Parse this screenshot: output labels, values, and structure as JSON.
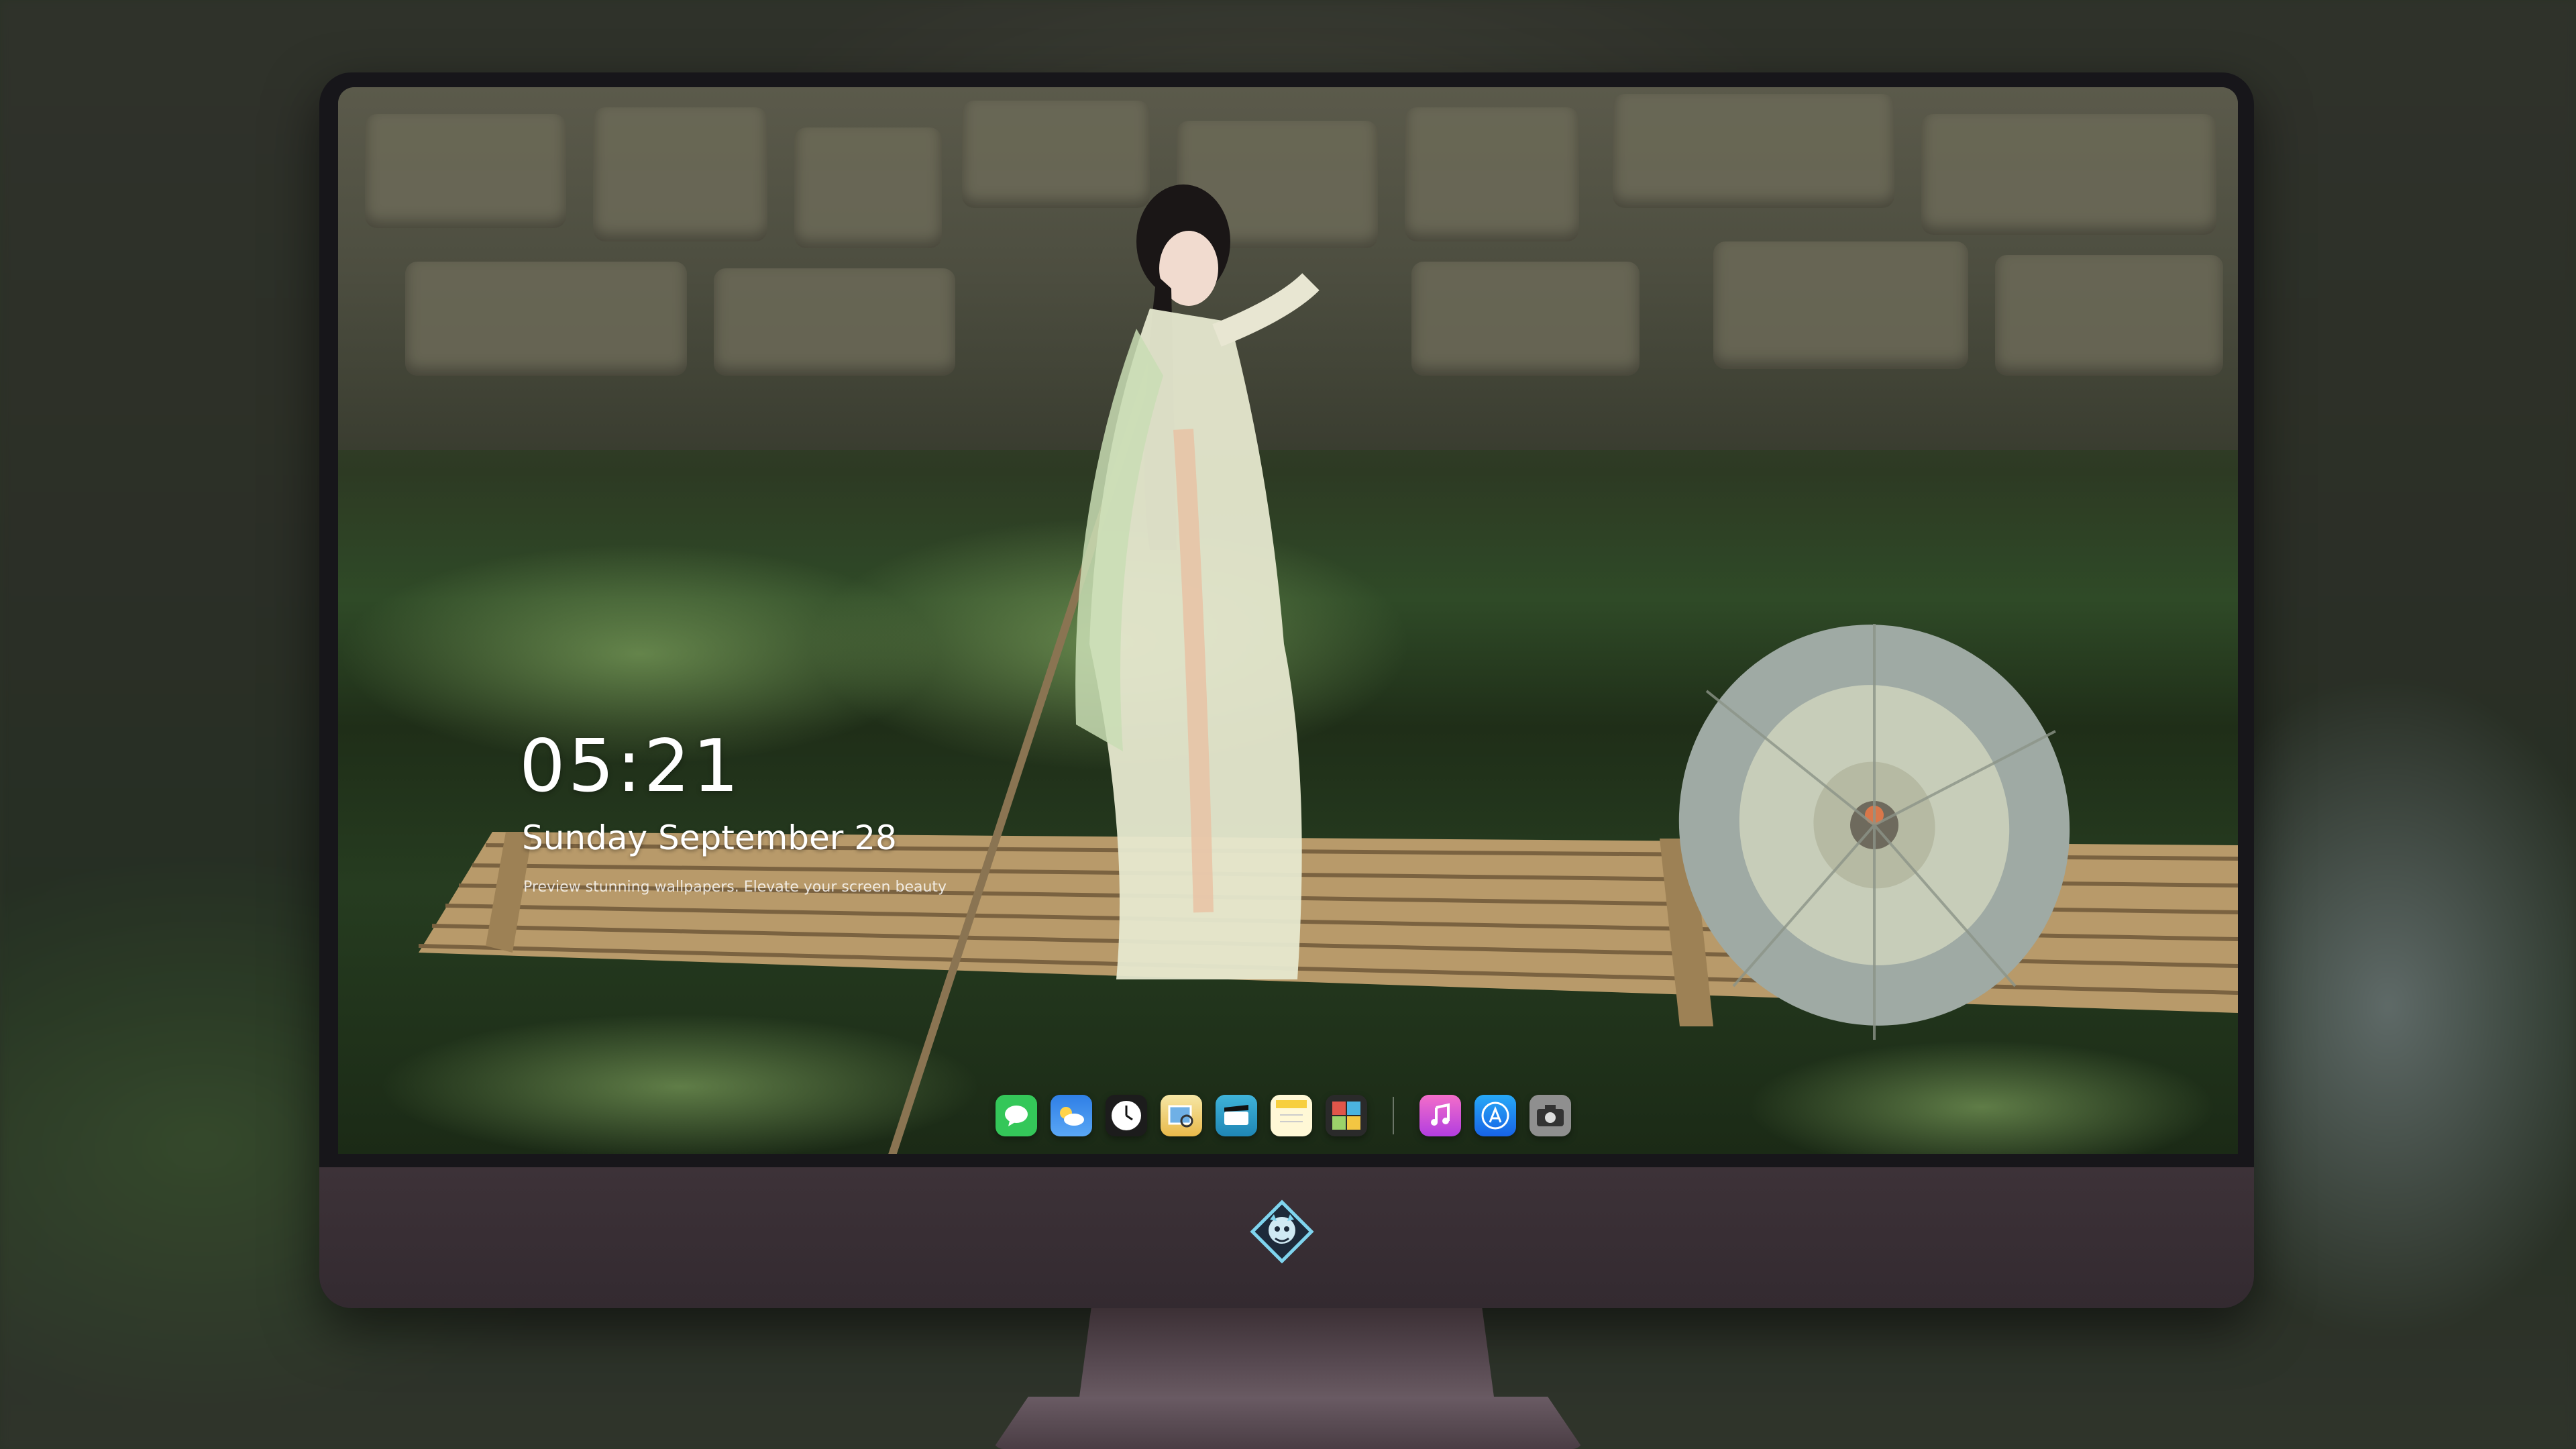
{
  "lockscreen": {
    "time": "05:21",
    "date": "Sunday September  28",
    "tagline": "Preview stunning wallpapers. Elevate your screen beauty"
  },
  "dock": {
    "apps": [
      {
        "name": "Messages",
        "icon": "messages-icon",
        "color": "#34c759",
        "glyph": "💬"
      },
      {
        "name": "Weather",
        "icon": "weather-icon",
        "color": "#3a8ef0",
        "glyph": "⛅"
      },
      {
        "name": "Clock",
        "icon": "clock-icon",
        "color": "#f2f2f2",
        "glyph": "🕓"
      },
      {
        "name": "Preview",
        "icon": "preview-icon",
        "color": "#f0d060",
        "glyph": "🖼"
      },
      {
        "name": "Clips",
        "icon": "clips-icon",
        "color": "#4ec3e0",
        "glyph": "🎬"
      },
      {
        "name": "Notes",
        "icon": "notes-icon",
        "color": "#fde57a",
        "glyph": "📝"
      },
      {
        "name": "Photo Booth",
        "icon": "photo-booth-icon",
        "color": "#e05a4a",
        "glyph": "▦"
      }
    ],
    "pinned": [
      {
        "name": "iTunes",
        "icon": "music-icon",
        "color": "#e94bb4",
        "glyph": "♫"
      },
      {
        "name": "App Store",
        "icon": "app-store-icon",
        "color": "#1b8cf0",
        "glyph": "Ⓐ"
      },
      {
        "name": "Camera",
        "icon": "camera-icon",
        "color": "#8d8d8d",
        "glyph": "📷"
      }
    ]
  }
}
